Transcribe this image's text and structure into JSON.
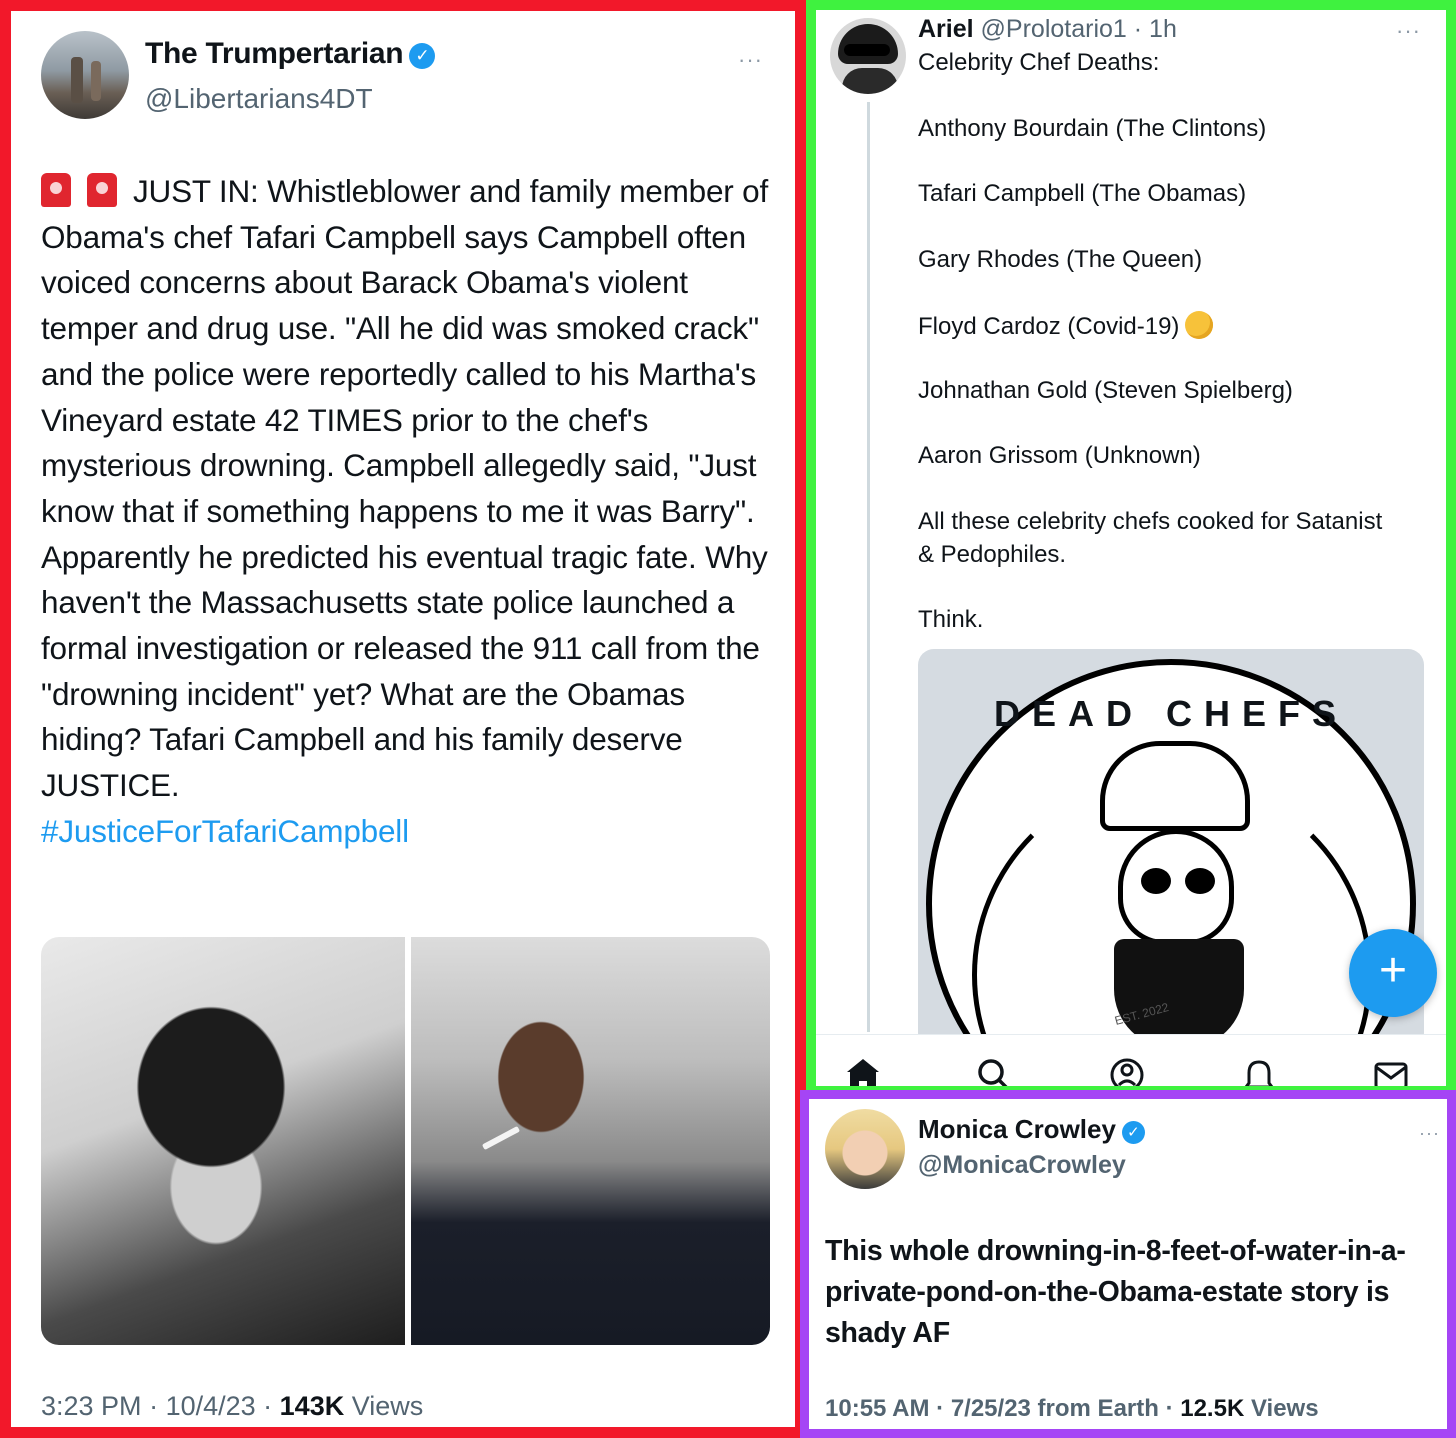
{
  "left_tweet": {
    "author_name": "The Trumpertarian",
    "handle": "@Libertarians4DT",
    "more": "···",
    "body_text": "JUST IN: Whistleblower and family member of Obama's chef Tafari Campbell says Campbell often voiced concerns about Barack Obama's violent temper and drug use. \"All he did was smoked crack\" and the police were reportedly called to his Martha's Vineyard estate 42 TIMES prior to the chef's mysterious drowning. Campbell allegedly said, \"Just know that if something happens to me it was Barry\". Apparently he predicted his eventual tragic fate. Why haven't the Massachusetts state police launched a formal investigation or released the 911 call from the \"drowning incident\" yet? What are the Obamas hiding? Tafari Campbell and his family deserve JUSTICE.",
    "hashtag": "#JusticeForTafariCampbell",
    "time": "3:23 PM",
    "date": "10/4/23",
    "views_count": "143K",
    "views_label": "Views"
  },
  "right_tweet": {
    "author_name": "Ariel",
    "handle": "@Prolotario1",
    "age": "1h",
    "more": "···",
    "intro": "Celebrity Chef Deaths:",
    "chefs": [
      "Anthony Bourdain (The Clintons)",
      "Tafari Campbell (The Obamas)",
      "Gary Rhodes (The Queen)",
      "Floyd Cardoz (Covid-19)",
      "Johnathan Gold (Steven Spielberg)",
      "Aaron Grissom (Unknown)"
    ],
    "conclusion_1": "All these celebrity chefs cooked for Satanist",
    "conclusion_2": "& Pedophiles.",
    "closing": "Think.",
    "image_title": "DEAD CHEFS",
    "image_est": "EST. 2022",
    "fab_label": "+"
  },
  "bottom_tweet": {
    "author_name": "Monica Crowley",
    "handle": "@MonicaCrowley",
    "more": "···",
    "body_text": "This whole drowning-in-8-feet-of-water-in-a-private-pond-on-the-Obama-estate story is shady AF",
    "time": "10:55 AM",
    "date_source": "7/25/23 from Earth",
    "views_count": "12.5K",
    "views_label": "Views"
  },
  "colors": {
    "left_frame": "#f2182a",
    "right_frame": "#3ff23f",
    "bottom_frame": "#a545f5",
    "accent": "#1d9bf0"
  },
  "icons": [
    "verified-badge-icon",
    "siren-icon",
    "wink-emoji-icon",
    "home-icon",
    "search-icon",
    "spaces-icon",
    "notifications-icon",
    "messages-icon",
    "compose-plus-icon"
  ]
}
